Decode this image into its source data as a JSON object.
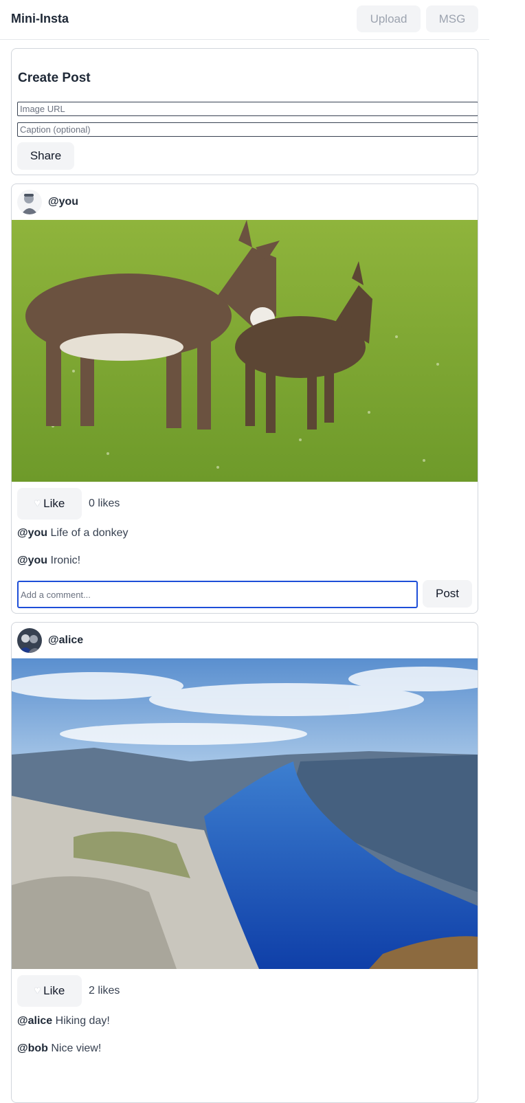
{
  "app": {
    "title": "Mini-Insta"
  },
  "toolbar": {
    "upload_label": "Upload",
    "msg_label": "MSG"
  },
  "create_post": {
    "heading": "Create Post",
    "image_url_placeholder": "Image URL",
    "caption_placeholder": "Caption (optional)",
    "share_label": "Share"
  },
  "posts": [
    {
      "username": "@you",
      "avatar_icon": "user-avatar-icon",
      "image_subject": "donkey-photo",
      "like_label": "Like",
      "like_icon": "heart-icon",
      "likes_text": "0 likes",
      "comments": [
        {
          "author": "@you",
          "text": "Life of a donkey"
        },
        {
          "author": "@you",
          "text": "Ironic!"
        }
      ],
      "comment_placeholder": "Add a comment...",
      "post_label": "Post"
    },
    {
      "username": "@alice",
      "avatar_icon": "user-avatar-icon",
      "image_subject": "fjord-photo",
      "like_label": "Like",
      "like_icon": "heart-icon",
      "likes_text": "2 likes",
      "comments": [
        {
          "author": "@alice",
          "text": "Hiking day!"
        },
        {
          "author": "@bob",
          "text": "Nice view!"
        }
      ]
    }
  ],
  "colors": {
    "focus_border": "#1d4ed8",
    "button_bg": "#f3f4f6",
    "card_border": "#d1d5db"
  }
}
